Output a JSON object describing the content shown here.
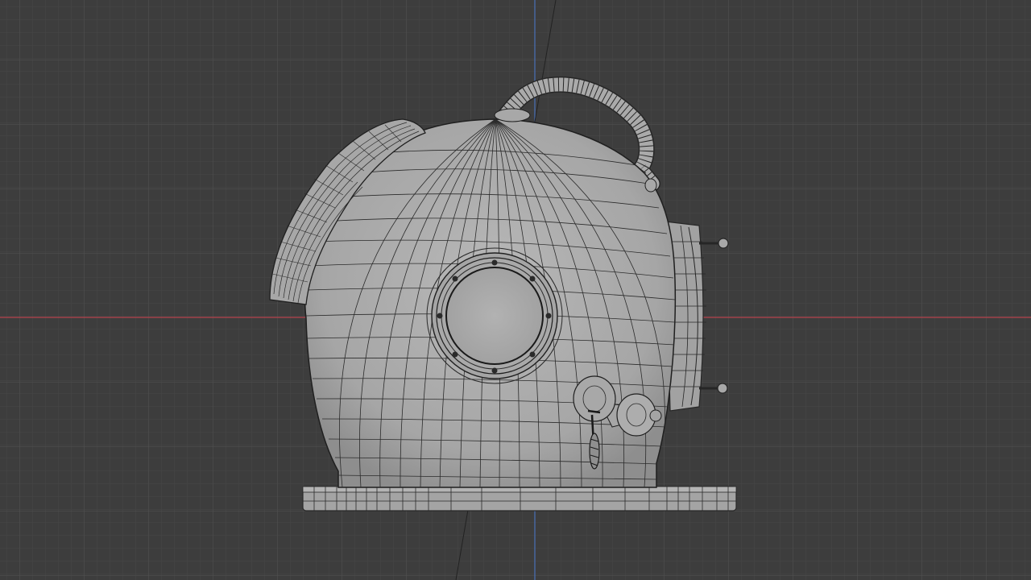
{
  "app": {
    "name": "3D Viewport"
  },
  "viewport": {
    "background": "#3d3d3d",
    "grid_minor_color": "#474747",
    "grid_major_color": "#545454",
    "x_axis_color": "#b5434d",
    "z_axis_color": "#4a70b8"
  },
  "model": {
    "name": "diving-helmet",
    "shading": "wireframe-overlay",
    "surface_color": "#a9a9a9",
    "wire_color": "#262626"
  }
}
